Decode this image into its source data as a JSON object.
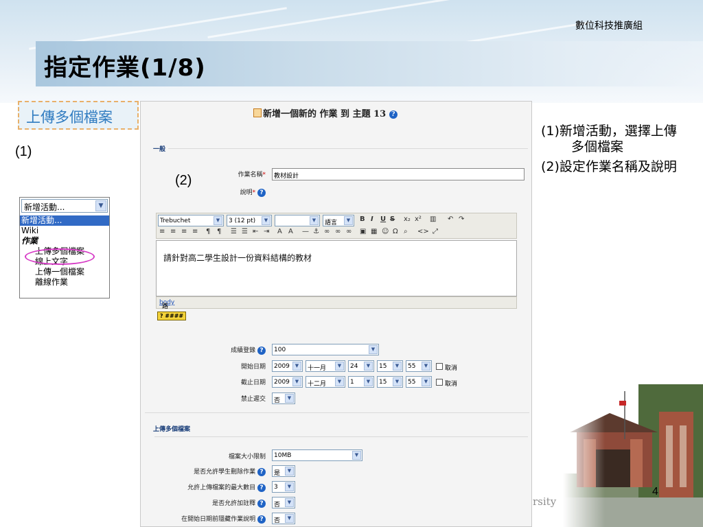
{
  "slide": {
    "org": "數位科技推廣組",
    "title": "指定作業(1/8)",
    "subheading": "上傳多個檔案",
    "step1_label": "(1)",
    "step2_label": "(2)",
    "page_number": "4",
    "watermark": "rsity"
  },
  "dropdown": {
    "selected": "新增活動...",
    "items": [
      {
        "label": "新增活動...",
        "style": "highlight"
      },
      {
        "label": "Wiki",
        "style": "normal"
      },
      {
        "label": "作業",
        "style": "group"
      },
      {
        "label": "上傳多個檔案",
        "style": "sub"
      },
      {
        "label": "線上文字",
        "style": "sub"
      },
      {
        "label": "上傳一個檔案",
        "style": "sub"
      },
      {
        "label": "離線作業",
        "style": "sub"
      }
    ]
  },
  "form": {
    "heading": "新增一個新的 作業 到 主題 13",
    "general_section": "一般",
    "name_label": "作業名稱",
    "name_value": "教材設計",
    "desc_label": "說明",
    "toolbar": {
      "font": "Trebuchet",
      "size": "3 (12 pt)",
      "style": "",
      "lang": "語言"
    },
    "editor_text": "請針對高二學生設計一份資料結構的教材",
    "path_label": "路徑:",
    "path_value": "body",
    "grade_label": "成績登錄",
    "grade_value": "100",
    "start_label": "開始日期",
    "start": {
      "year": "2009",
      "month": "十一月",
      "day": "24",
      "hour": "15",
      "minute": "55"
    },
    "due_label": "截止日期",
    "due": {
      "year": "2009",
      "month": "十二月",
      "day": "1",
      "hour": "15",
      "minute": "55"
    },
    "disable_label": "取消",
    "prevent_late_label": "禁止遲交",
    "prevent_late_value": "否",
    "upload_section": "上傳多個檔案",
    "max_size_label": "檔案大小限制",
    "max_size_value": "10MB",
    "allow_delete_label": "是否允許學生刪除作業",
    "allow_delete_value": "是",
    "max_files_label": "允許上傳檔案的最大數目",
    "max_files_value": "3",
    "allow_notes_label": "是否允許加註釋",
    "allow_notes_value": "否",
    "hide_desc_label": "在開始日期前隱藏作業說明",
    "hide_desc_value": "否"
  },
  "notes": [
    "(1)新增活動，選擇上傳多個檔案",
    "(2)設定作業名稱及說明"
  ]
}
